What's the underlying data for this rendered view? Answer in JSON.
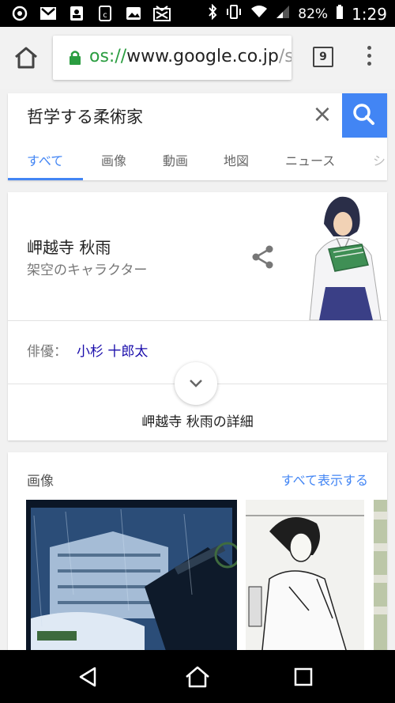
{
  "status_bar": {
    "battery": "82%",
    "time": "1:29"
  },
  "browser": {
    "url_scheme": "os://",
    "url_domain": "www.google.co.jp",
    "url_tail": "/se",
    "tab_count": "9"
  },
  "search": {
    "query": "哲学する柔術家",
    "clear_label": "×",
    "tabs": [
      "すべて",
      "画像",
      "動画",
      "地図",
      "ニュース",
      "シ"
    ]
  },
  "knowledge_panel": {
    "title": "岬越寺 秋雨",
    "subtitle": "架空のキャラクター",
    "actor_label": "俳優：",
    "actor_name": "小杉 十郎太",
    "details_label": "岬越寺 秋雨の詳細"
  },
  "images_section": {
    "heading": "画像",
    "see_all": "すべて表示する"
  },
  "colors": {
    "accent": "#4285f4",
    "link": "#1a0dab",
    "lock": "#2a9d40"
  }
}
